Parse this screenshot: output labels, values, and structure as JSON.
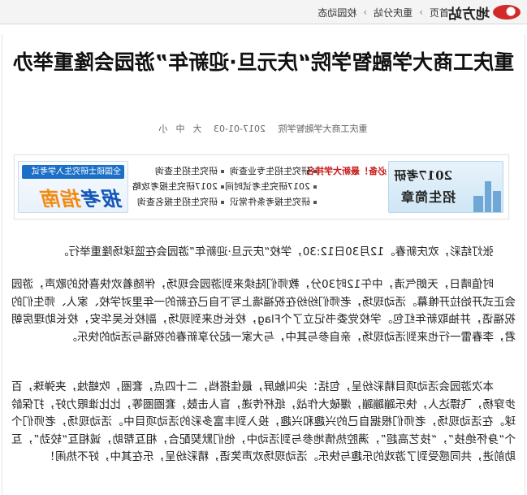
{
  "site": {
    "logo_text": "地方站",
    "breadcrumbs": [
      "首页",
      "重庆分站",
      "校园动态"
    ]
  },
  "article": {
    "title": "重庆工商大学融智学院“庆元旦·迎新年”游园会隆重举办",
    "source": "重庆工商大学融智学院",
    "date": "2017-01-03",
    "font_sizes": [
      "大",
      "中",
      "小"
    ]
  },
  "banner": {
    "left_promo": {
      "line1": "2017考研",
      "line2": "招生简章"
    },
    "red_links": [
      "必备！最新大学排名"
    ],
    "links_col1": [
      "研究生招生专业查询",
      "2017研究生考试时间",
      "研究生报考条件常识"
    ],
    "links_col2": [
      "研究生招生查询",
      "2017研究生报考攻略",
      "研究生招生报名查询"
    ],
    "right_promo": {
      "strip": "全国硕士研究生入学考试",
      "big_part1": "报考",
      "big_part2": "指南"
    }
  },
  "paragraphs": [
    "张灯结彩，欢庆新春。12月30日12:30，学校“庆元旦·迎新年”游园会在篮球场隆重举行。",
    "时值晴日，天朗气清，中午12时30分，教师们陆续来到游园会现场，伴随着欢快喜悦的歌声，游园会正式开始拉开帷幕。活动现场，老师们纷纷在祝福墙上写下自己在新的一年里对学校、家人、师生们的祝福语，并抽取新年红包。学校党委书记立了个Flag，校长也来到现场，副校长吴华安，校长助理房朝君，李春雷一行也来到活动现场，亲自参与其中，与大家一起分享新春的祝福与活动的快乐。",
    "本次游园会活动项目精彩纷呈，包括：尖叫触屏，最佳搭档，二十四点，套圈，吹蜡烛，夹弹珠，百步穿杨，飞镖达人，快乐蹦蹦蹦，爆破大作战，纸杯传递，盲人击鼓，套圈圈等，比比谁眼力好，打保龄球。在活动现场，老师们根据自己的兴趣和兴趣，投入到丰富多彩的活动项目中。活动现场，老师们个个“身怀绝技”，“技艺高超”，满腔热情地参与到活动中，他们默契配合，相互帮助，诚相互“较劲”，互助前进，共同感受到了游戏的乐趣与快乐。活动现场欢声笑语，精彩纷呈，乐在其中，好不热闹！"
  ]
}
